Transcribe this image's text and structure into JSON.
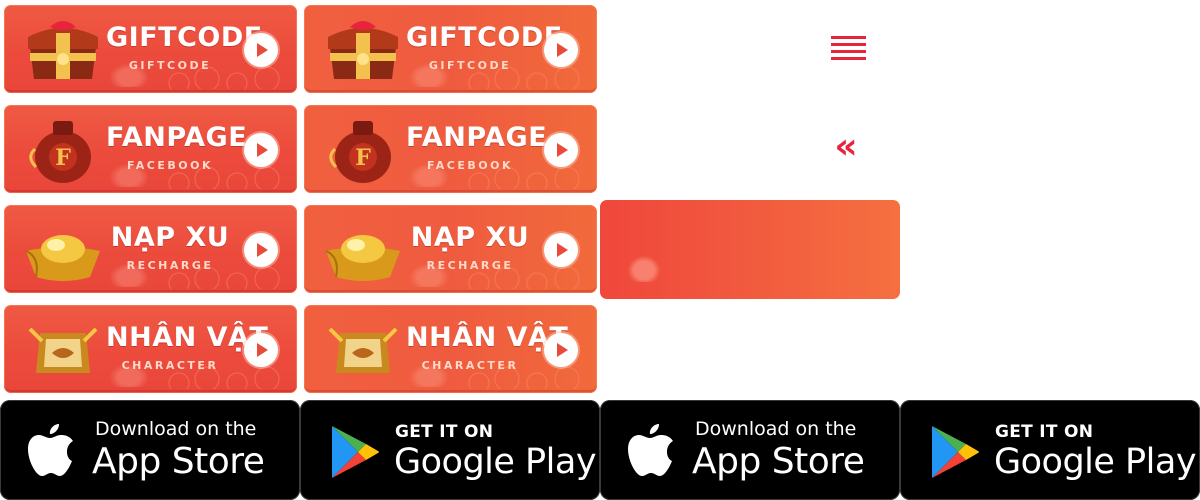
{
  "buttons": [
    {
      "icon": "gift-chest-icon",
      "title": "GIFTCODE",
      "subtitle": "GIFTCODE"
    },
    {
      "icon": "gourd-jar-icon",
      "title": "FANPAGE",
      "subtitle": "FACEBOOK"
    },
    {
      "icon": "gold-ingot-icon",
      "title": "NẠP XU",
      "subtitle": "RECHARGE"
    },
    {
      "icon": "character-emblem-icon",
      "title": "NHÂN VẬT",
      "subtitle": "CHARACTER"
    }
  ],
  "controls": {
    "menu_icon": "hamburger-menu-icon",
    "collapse_icon": "double-chevron-left-icon",
    "collapse_glyph": "«"
  },
  "stores": {
    "appstore": {
      "small": "Download on the",
      "big": "App Store",
      "icon": "apple-icon"
    },
    "googleplay": {
      "small": "GET IT ON",
      "big": "Google Play",
      "icon": "google-play-icon"
    }
  },
  "colors": {
    "accent": "#e8243c",
    "button_red": "#ec4b3c",
    "button_orange": "#f16a3b",
    "store_bg": "#000000"
  }
}
